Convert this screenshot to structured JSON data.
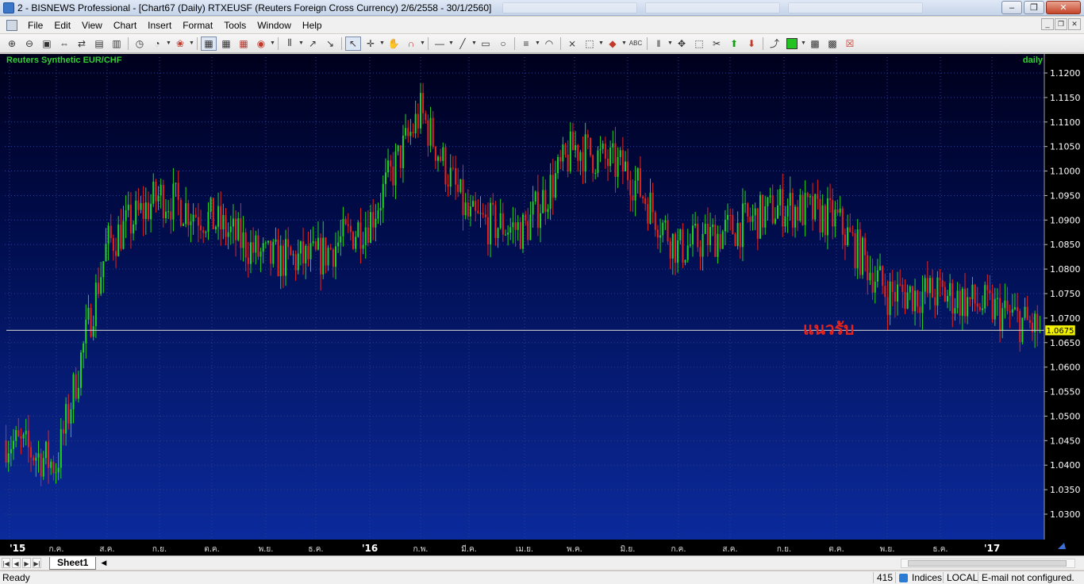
{
  "window": {
    "title": "2 - BISNEWS Professional - [Chart67 (Daily)  RTXEUSF (Reuters Foreign Cross Currency) 2/6/2558 - 30/1/2560]"
  },
  "menu": [
    "File",
    "Edit",
    "View",
    "Chart",
    "Insert",
    "Format",
    "Tools",
    "Window",
    "Help"
  ],
  "chart": {
    "instrument": "Reuters Synthetic EUR/CHF",
    "period": "daily",
    "y_ticks": [
      "1.1200",
      "1.1150",
      "1.1100",
      "1.1050",
      "1.1000",
      "1.0950",
      "1.0900",
      "1.0850",
      "1.0800",
      "1.0750",
      "1.0700",
      "1.0650",
      "1.0600",
      "1.0550",
      "1.0500",
      "1.0450",
      "1.0400",
      "1.0350",
      "1.0300"
    ],
    "x_ticks": [
      "'15",
      "ก.ค.",
      "ส.ค.",
      "ก.ย.",
      "ต.ค.",
      "พ.ย.",
      "ธ.ค.",
      "'16",
      "ก.พ.",
      "มี.ค.",
      "เม.ย.",
      "พ.ค.",
      "มิ.ย.",
      "ก.ค.",
      "ส.ค.",
      "ก.ย.",
      "ต.ค.",
      "พ.ย.",
      "ธ.ค.",
      "'17"
    ],
    "last_price": "1.0675",
    "support_label": "แนวรับ",
    "colors": {
      "up": "#22d422",
      "down": "#e8231c",
      "support_line": "#c8c8c8",
      "support_text": "#e8231c",
      "label_green": "#2fd12f",
      "price_flag": "#f0f000"
    }
  },
  "chart_data": {
    "type": "candlestick",
    "title": "Reuters Synthetic EUR/CHF",
    "period": "daily",
    "ylim": [
      1.025,
      1.121
    ],
    "y_axis": "right",
    "support_level": 1.0675,
    "last_price": 1.0675,
    "x_range": [
      "2/6/2558",
      "30/1/2560"
    ],
    "trend_anchors": [
      {
        "x": "'15",
        "y": 1.045
      },
      {
        "x": "ก.ค.",
        "y": 1.04
      },
      {
        "x": "ส.ค.",
        "y": 1.085
      },
      {
        "x": "ก.ย.",
        "y": 1.095
      },
      {
        "x": "ต.ค.",
        "y": 1.09
      },
      {
        "x": "พ.ย.",
        "y": 1.082
      },
      {
        "x": "ธ.ค.",
        "y": 1.082
      },
      {
        "x": "'16",
        "y": 1.09
      },
      {
        "x": "ก.พ.",
        "y": 1.112
      },
      {
        "x": "มี.ค.",
        "y": 1.09
      },
      {
        "x": "เม.ย.",
        "y": 1.088
      },
      {
        "x": "พ.ค.",
        "y": 1.105
      },
      {
        "x": "มิ.ย.",
        "y": 1.1
      },
      {
        "x": "ก.ค.",
        "y": 1.084
      },
      {
        "x": "ส.ค.",
        "y": 1.088
      },
      {
        "x": "ก.ย.",
        "y": 1.093
      },
      {
        "x": "ต.ค.",
        "y": 1.09
      },
      {
        "x": "พ.ย.",
        "y": 1.075
      },
      {
        "x": "ธ.ค.",
        "y": 1.075
      },
      {
        "x": "'17",
        "y": 1.072
      }
    ]
  },
  "sheet": {
    "tab": "Sheet1"
  },
  "status": {
    "ready": "Ready",
    "count": "415",
    "indices": "Indices",
    "local": "LOCAL",
    "email": "E-mail not configured."
  }
}
